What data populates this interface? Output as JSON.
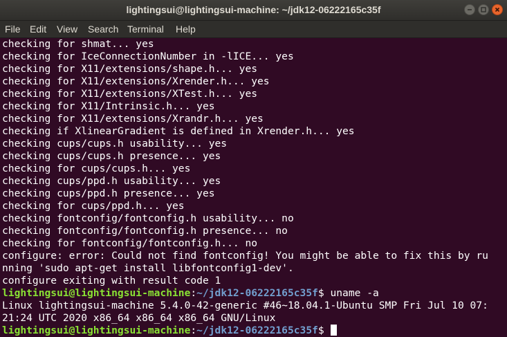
{
  "window": {
    "title": "lightingsui@lightingsui-machine: ~/jdk12-06222165c35f",
    "buttons": {
      "minimize_icon": "minimize-icon",
      "maximize_icon": "maximize-icon",
      "close_icon": "close-icon",
      "close_color": "#e9652c"
    }
  },
  "menu": {
    "file": "File",
    "edit": "Edit",
    "view": "View",
    "search": "Search",
    "terminal": "Terminal",
    "help": "Help"
  },
  "colors": {
    "background": "#300a24",
    "prompt_user": "#8ae234",
    "prompt_path": "#729fcf",
    "text": "#ffffff"
  },
  "terminal": {
    "output_lines": [
      "checking for shmat... yes",
      "checking for IceConnectionNumber in -lICE... yes",
      "checking for X11/extensions/shape.h... yes",
      "checking for X11/extensions/Xrender.h... yes",
      "checking for X11/extensions/XTest.h... yes",
      "checking for X11/Intrinsic.h... yes",
      "checking for X11/extensions/Xrandr.h... yes",
      "checking if XlinearGradient is defined in Xrender.h... yes",
      "checking cups/cups.h usability... yes",
      "checking cups/cups.h presence... yes",
      "checking for cups/cups.h... yes",
      "checking cups/ppd.h usability... yes",
      "checking cups/ppd.h presence... yes",
      "checking for cups/ppd.h... yes",
      "checking fontconfig/fontconfig.h usability... no",
      "checking fontconfig/fontconfig.h presence... no",
      "checking for fontconfig/fontconfig.h... no",
      "configure: error: Could not find fontconfig! You might be able to fix this by ru",
      "nning 'sudo apt-get install libfontconfig1-dev'.",
      "configure exiting with result code 1"
    ],
    "prompt1": {
      "user": "lightingsui@lightingsui-machine",
      "sep": ":",
      "path": "~/jdk12-06222165c35f",
      "dollar": "$",
      "command": " uname -a"
    },
    "uname_lines": [
      "Linux lightingsui-machine 5.4.0-42-generic #46~18.04.1-Ubuntu SMP Fri Jul 10 07:",
      "21:24 UTC 2020 x86_64 x86_64 x86_64 GNU/Linux"
    ],
    "prompt2": {
      "user": "lightingsui@lightingsui-machine",
      "sep": ":",
      "path": "~/jdk12-06222165c35f",
      "dollar": "$",
      "command": " "
    }
  }
}
